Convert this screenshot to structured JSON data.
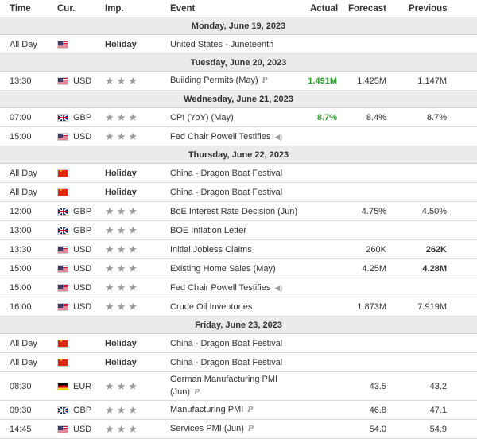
{
  "header": {
    "time": "Time",
    "currency": "Cur.",
    "importance": "Imp.",
    "event": "Event",
    "actual": "Actual",
    "forecast": "Forecast",
    "previous": "Previous"
  },
  "days": [
    {
      "date": "Monday, June 19, 2023",
      "events": [
        {
          "time": "All Day",
          "flag": "us",
          "currency": "",
          "holiday": "Holiday",
          "event": "United States - Juneteenth",
          "actual": "",
          "forecast": "",
          "previous": ""
        }
      ]
    },
    {
      "date": "Tuesday, June 20, 2023",
      "events": [
        {
          "time": "13:30",
          "flag": "us",
          "currency": "USD",
          "event": "Building Permits (May)",
          "icon": "preliminary-icon",
          "actual": "1.491M",
          "actual_color": "#2ca02c",
          "forecast": "1.425M",
          "previous": "1.147M"
        }
      ]
    },
    {
      "date": "Wednesday, June 21, 2023",
      "events": [
        {
          "time": "07:00",
          "flag": "gb",
          "currency": "GBP",
          "event": "CPI (YoY) (May)",
          "actual": "8.7%",
          "actual_color": "#2ca02c",
          "forecast": "8.4%",
          "previous": "8.7%"
        },
        {
          "time": "15:00",
          "flag": "us",
          "currency": "USD",
          "event": "Fed Chair Powell Testifies",
          "icon": "speaker-icon",
          "actual": "",
          "forecast": "",
          "previous": ""
        }
      ]
    },
    {
      "date": "Thursday, June 22, 2023",
      "events": [
        {
          "time": "All Day",
          "flag": "cn",
          "currency": "",
          "holiday": "Holiday",
          "event": "China - Dragon Boat Festival",
          "actual": "",
          "forecast": "",
          "previous": ""
        },
        {
          "time": "All Day",
          "flag": "cn",
          "currency": "",
          "holiday": "Holiday",
          "event": "China - Dragon Boat Festival",
          "actual": "",
          "forecast": "",
          "previous": ""
        },
        {
          "time": "12:00",
          "flag": "gb",
          "currency": "GBP",
          "event": "BoE Interest Rate Decision (Jun)",
          "actual": "",
          "forecast": "4.75%",
          "previous": "4.50%"
        },
        {
          "time": "13:00",
          "flag": "gb",
          "currency": "GBP",
          "event": "BOE Inflation Letter",
          "actual": "",
          "forecast": "",
          "previous": ""
        },
        {
          "time": "13:30",
          "flag": "us",
          "currency": "USD",
          "event": "Initial Jobless Claims",
          "actual": "",
          "forecast": "260K",
          "previous": "262K",
          "previous_bold": true
        },
        {
          "time": "15:00",
          "flag": "us",
          "currency": "USD",
          "event": "Existing Home Sales (May)",
          "actual": "",
          "forecast": "4.25M",
          "previous": "4.28M",
          "previous_bold": true
        },
        {
          "time": "15:00",
          "flag": "us",
          "currency": "USD",
          "event": "Fed Chair Powell Testifies",
          "icon": "speaker-icon",
          "actual": "",
          "forecast": "",
          "previous": ""
        },
        {
          "time": "16:00",
          "flag": "us",
          "currency": "USD",
          "event": "Crude Oil Inventories",
          "actual": "",
          "forecast": "1.873M",
          "previous": "7.919M"
        }
      ]
    },
    {
      "date": "Friday, June 23, 2023",
      "events": [
        {
          "time": "All Day",
          "flag": "cn",
          "currency": "",
          "holiday": "Holiday",
          "event": "China - Dragon Boat Festival",
          "actual": "",
          "forecast": "",
          "previous": ""
        },
        {
          "time": "All Day",
          "flag": "cn",
          "currency": "",
          "holiday": "Holiday",
          "event": "China - Dragon Boat Festival",
          "actual": "",
          "forecast": "",
          "previous": ""
        },
        {
          "time": "08:30",
          "flag": "de",
          "currency": "EUR",
          "event": "German Manufacturing PMI",
          "event_line2": "(Jun)",
          "icon": "preliminary-icon",
          "actual": "",
          "forecast": "43.5",
          "previous": "43.2",
          "tall": true
        },
        {
          "time": "09:30",
          "flag": "gb",
          "currency": "GBP",
          "event": "Manufacturing PMI",
          "icon": "preliminary-icon",
          "actual": "",
          "forecast": "46.8",
          "previous": "47.1"
        },
        {
          "time": "14:45",
          "flag": "us",
          "currency": "USD",
          "event": "Services PMI (Jun)",
          "icon": "preliminary-icon",
          "actual": "",
          "forecast": "54.0",
          "previous": "54.9"
        }
      ]
    }
  ]
}
